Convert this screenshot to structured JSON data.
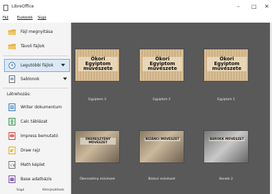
{
  "window": {
    "title": "LibreOffice",
    "controls": [
      "–",
      "□",
      "✕"
    ]
  },
  "menubar": [
    "Fájl",
    "Eszközök",
    "Súgó"
  ],
  "sidebar": {
    "open_file": "Fájl megnyitása",
    "remote_files": "Távoli fájlok",
    "recent_files": "Legutóbbi fájlok",
    "templates": "Sablonok",
    "create_heading": "Létrehozás:",
    "create_items": [
      "Writer dokumentum",
      "Calc táblázat",
      "Impress bemutató",
      "Draw rajz",
      "Math képlet",
      "Base adatbázis"
    ],
    "footer": {
      "help": "Súgó",
      "extensions": "Kiterjesztések"
    }
  },
  "templates": [
    {
      "title": "Ókori Egyiptom művészete",
      "caption": "Egyiptom 3"
    },
    {
      "title": "Ókori Egyiptom művészete",
      "caption": "Egyiptom 2"
    },
    {
      "title": "Ókori Egyiptom művészete",
      "caption": "Egyiptom 1"
    },
    {
      "title": "ÓKERESZTÉNY MŰVÉSZET",
      "caption": "Ókeresztény művészet"
    },
    {
      "title": "BIZÁNCI MŰVÉSZET",
      "caption": "Bizánci művészet"
    },
    {
      "title": "BAROKK MŰVÉSZET",
      "caption": "Barokk 2"
    }
  ],
  "colors": {
    "content_bg": "#595959",
    "selected_bg": "#dbe8f6"
  }
}
